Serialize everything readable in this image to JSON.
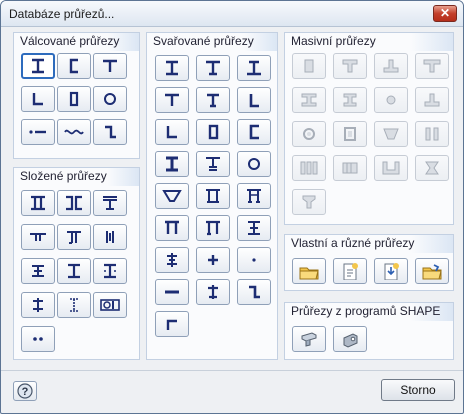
{
  "window": {
    "title": "Databáze průřezů...",
    "close_glyph": "✕"
  },
  "panels": {
    "rolled": "Válcované průřezy",
    "built_up": "Složené průřezy",
    "welded": "Svařované průřezy",
    "massive": "Masivní průřezy",
    "user": "Vlastní a různé průřezy",
    "shape": "Průřezy z programů SHAPE"
  },
  "icons": {
    "rolled": [
      "i-beam-icon",
      "channel-icon",
      "tee-icon",
      "angle-icon",
      "rectangular-hollow-icon",
      "circular-hollow-icon",
      "flat-bar-icon",
      "sheet-pile-icon",
      "z-section-icon"
    ],
    "built_up": [
      "double-i-icon",
      "double-channel-face-icon",
      "i-with-tee-icon",
      "double-angle-t-icon",
      "double-angle-t-alt-icon",
      "channel-pair-icon",
      "i-with-plates-icon",
      "i-with-cover-plate-icon",
      "i-with-side-plates-icon",
      "angle-cross-icon",
      "castellated-i-icon",
      "i-channel-combo-icon",
      "double-dot-icon"
    ],
    "welded": [
      "welded-i-icon",
      "welded-i-unsymmetric-icon",
      "welded-i-tapered-icon",
      "welded-tee-icon",
      "welded-tee-alt-icon",
      "welded-angle-icon",
      "welded-angle-alt-icon",
      "welded-box-icon",
      "welded-channel-icon",
      "welded-i-heavy-icon",
      "welded-tee-flange-icon",
      "welded-circle-icon",
      "welded-trough-icon",
      "welded-box-flange-icon",
      "welded-box-lipped-icon",
      "welded-pi-icon",
      "welded-pi-alt-icon",
      "welded-i-stiffened-icon",
      "welded-cross-i-icon",
      "welded-plus-icon",
      "welded-dot-icon",
      "welded-flat-icon",
      "welded-tee-stub-icon",
      "welded-z-icon",
      "welded-z-alt-icon"
    ],
    "massive": [
      "solid-rectangle-icon",
      "solid-tee-icon",
      "solid-inverted-tee-icon",
      "solid-tee-wide-icon",
      "solid-i-icon",
      "solid-i-stiff-icon",
      "solid-circle-icon",
      "solid-tee-slab-icon",
      "solid-ring-icon",
      "solid-box-icon",
      "solid-trapezoid-icon",
      "solid-double-web-icon",
      "solid-triple-web-icon",
      "solid-multi-web-icon",
      "solid-u-icon",
      "solid-hourglass-icon",
      "solid-t-taper-icon"
    ],
    "user": [
      "open-folder-icon",
      "new-section-icon",
      "import-section-icon",
      "folder-export-icon"
    ],
    "shape": [
      "shape-thin-icon",
      "shape-massive-icon"
    ]
  },
  "buttons": {
    "storno": "Storno",
    "help_glyph": "?"
  }
}
